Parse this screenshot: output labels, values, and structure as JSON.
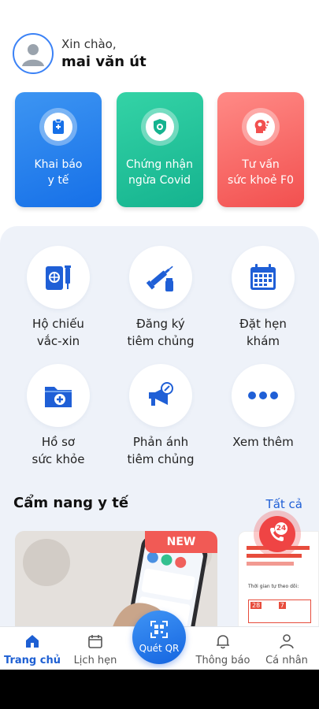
{
  "header": {
    "greeting": "Xin chào,",
    "user_name": "mai văn út"
  },
  "quick_cards": [
    {
      "label_line1": "Khai báo",
      "label_line2": "y tế",
      "color": "#1670e8",
      "icon": "clipboard-icon"
    },
    {
      "label_line1": "Chứng nhận",
      "label_line2": "ngừa Covid",
      "color": "#15b38f",
      "icon": "virus-shield-icon"
    },
    {
      "label_line1": "Tư vấn",
      "label_line2": "sức khoẻ F0",
      "color": "#f2504f",
      "icon": "head-virus-icon"
    }
  ],
  "services": [
    {
      "line1": "Hộ chiếu",
      "line2": "vắc-xin",
      "icon": "passport-syringe-icon"
    },
    {
      "line1": "Đăng ký",
      "line2": "tiêm chủng",
      "icon": "syringe-vial-icon"
    },
    {
      "line1": "Đặt hẹn",
      "line2": "khám",
      "icon": "calendar-icon"
    },
    {
      "line1": "Hồ sơ",
      "line2": "sức khỏe",
      "icon": "medical-folder-icon"
    },
    {
      "line1": "Phản ánh",
      "line2": "tiêm chủng",
      "icon": "megaphone-icon"
    },
    {
      "line1": "Xem thêm",
      "line2": "",
      "icon": "more-dots-icon"
    }
  ],
  "news": {
    "title": "Cẩm nang y tế",
    "see_all": "Tất cả",
    "badge": "NEW",
    "card2_text": "Thời gian tự theo dõi:",
    "card2_days": "28",
    "card2_days2": "7"
  },
  "hotline": {
    "number": "24"
  },
  "bottom_nav": {
    "home": "Trang chủ",
    "schedule": "Lịch hẹn",
    "qr": "Quét QR",
    "notifications": "Thông báo",
    "profile": "Cá nhân"
  },
  "colors": {
    "accent": "#1d5fd3",
    "panel": "#eef2f9"
  }
}
